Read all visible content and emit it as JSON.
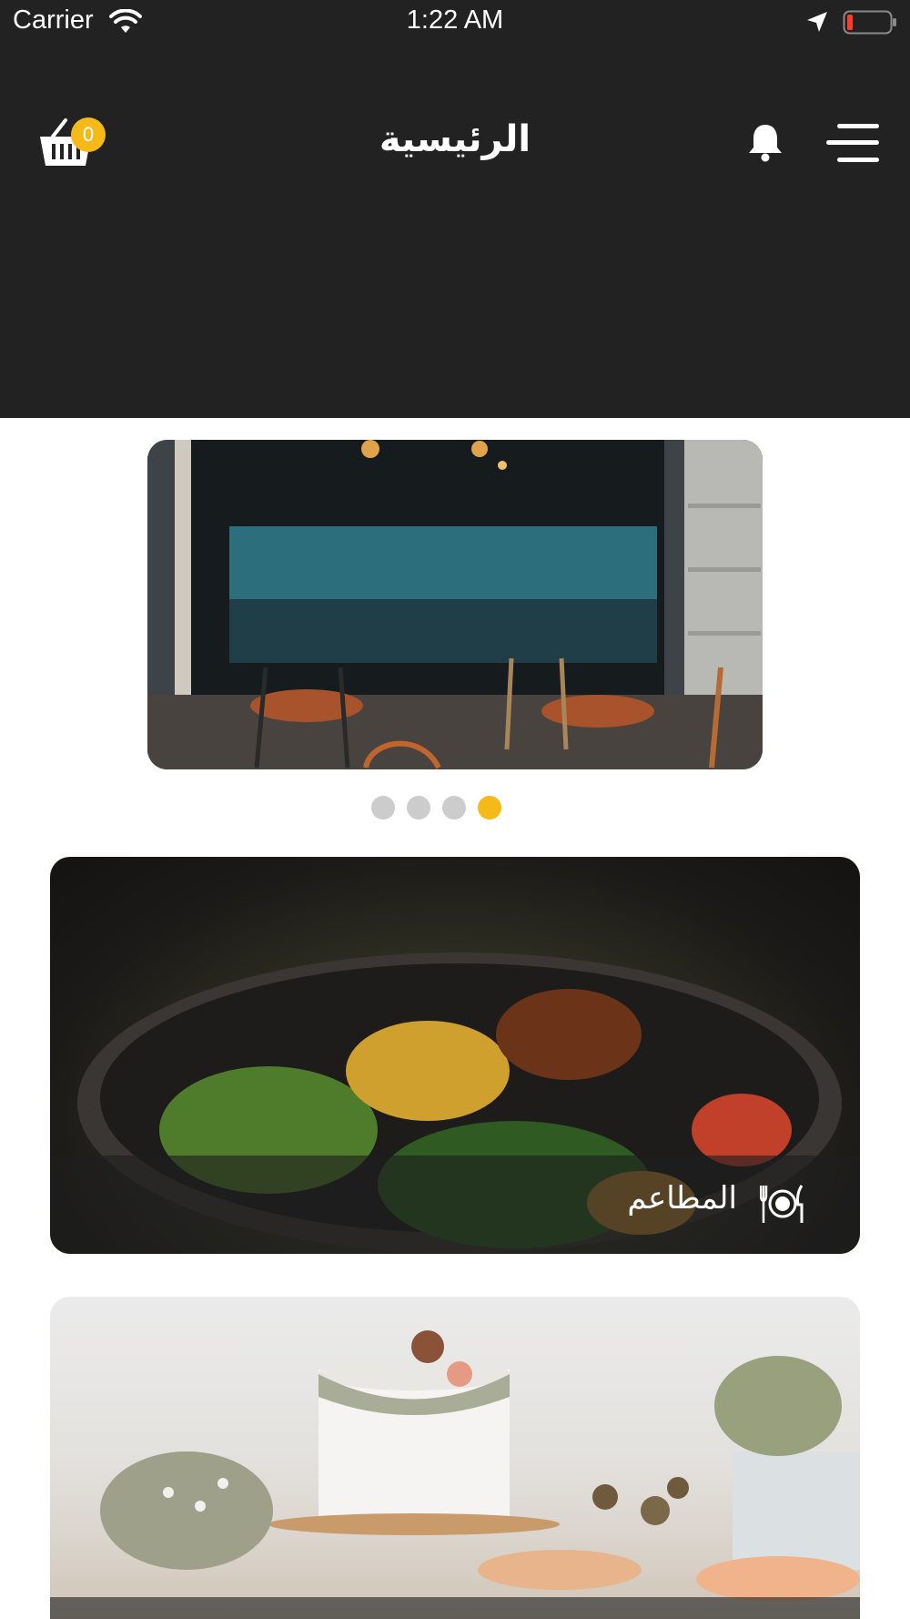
{
  "status_bar": {
    "carrier": "Carrier",
    "time": "1:22 AM",
    "icons": [
      "wifi-icon",
      "location-arrow-icon",
      "battery-low-icon"
    ]
  },
  "header": {
    "title": "الرئيسية",
    "cart_count": "0",
    "icons": [
      "basket-icon",
      "bell-icon",
      "hamburger-menu-icon"
    ]
  },
  "slider": {
    "dot_count": 4,
    "active_index": 3
  },
  "categories": [
    {
      "label": "المطاعم",
      "icon": "fork-plate-knife-icon"
    },
    {
      "label": "",
      "icon": ""
    }
  ],
  "colors": {
    "header_bg": "#222222",
    "accent": "#f6b91a",
    "dot_inactive": "#cccccc",
    "page_bg": "#ffffff"
  }
}
